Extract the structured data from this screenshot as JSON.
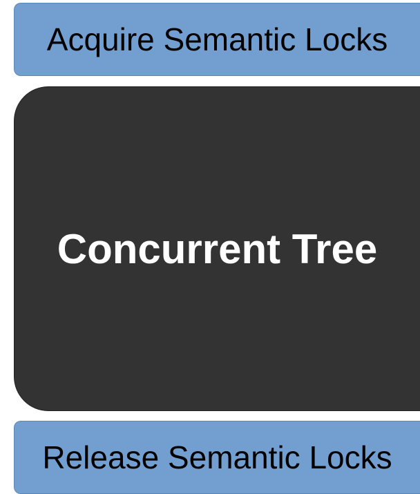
{
  "diagram": {
    "top_block": {
      "label": "Acquire Semantic Locks",
      "color": "#729fcf"
    },
    "middle_block": {
      "label": "Concurrent Tree",
      "color": "#333333"
    },
    "bottom_block": {
      "label": "Release Semantic Locks",
      "color": "#729fcf"
    }
  }
}
